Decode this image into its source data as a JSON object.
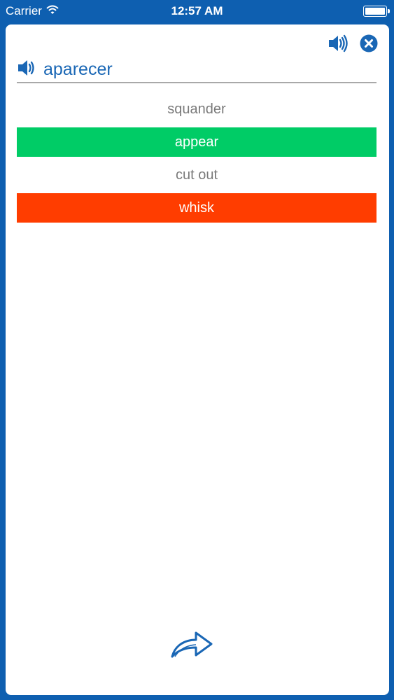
{
  "status_bar": {
    "carrier": "Carrier",
    "time": "12:57 AM",
    "battery_level": 1.0
  },
  "header": {
    "speaker_icon": "speaker-icon",
    "close_icon": "close-icon"
  },
  "quiz": {
    "word": "aparecer",
    "word_speaker_icon": "speaker-icon",
    "options": [
      {
        "label": "squander",
        "state": "neutral"
      },
      {
        "label": "appear",
        "state": "correct"
      },
      {
        "label": "cut out",
        "state": "neutral"
      },
      {
        "label": "whisk",
        "state": "wrong"
      }
    ]
  },
  "footer": {
    "next_icon": "forward-arrow-icon"
  },
  "colors": {
    "frame_blue": "#0e5fb0",
    "accent_blue": "#1a67b5",
    "correct_green": "#00cc66",
    "wrong_red": "#ff3d00",
    "neutral_text": "#7a7a7a"
  }
}
